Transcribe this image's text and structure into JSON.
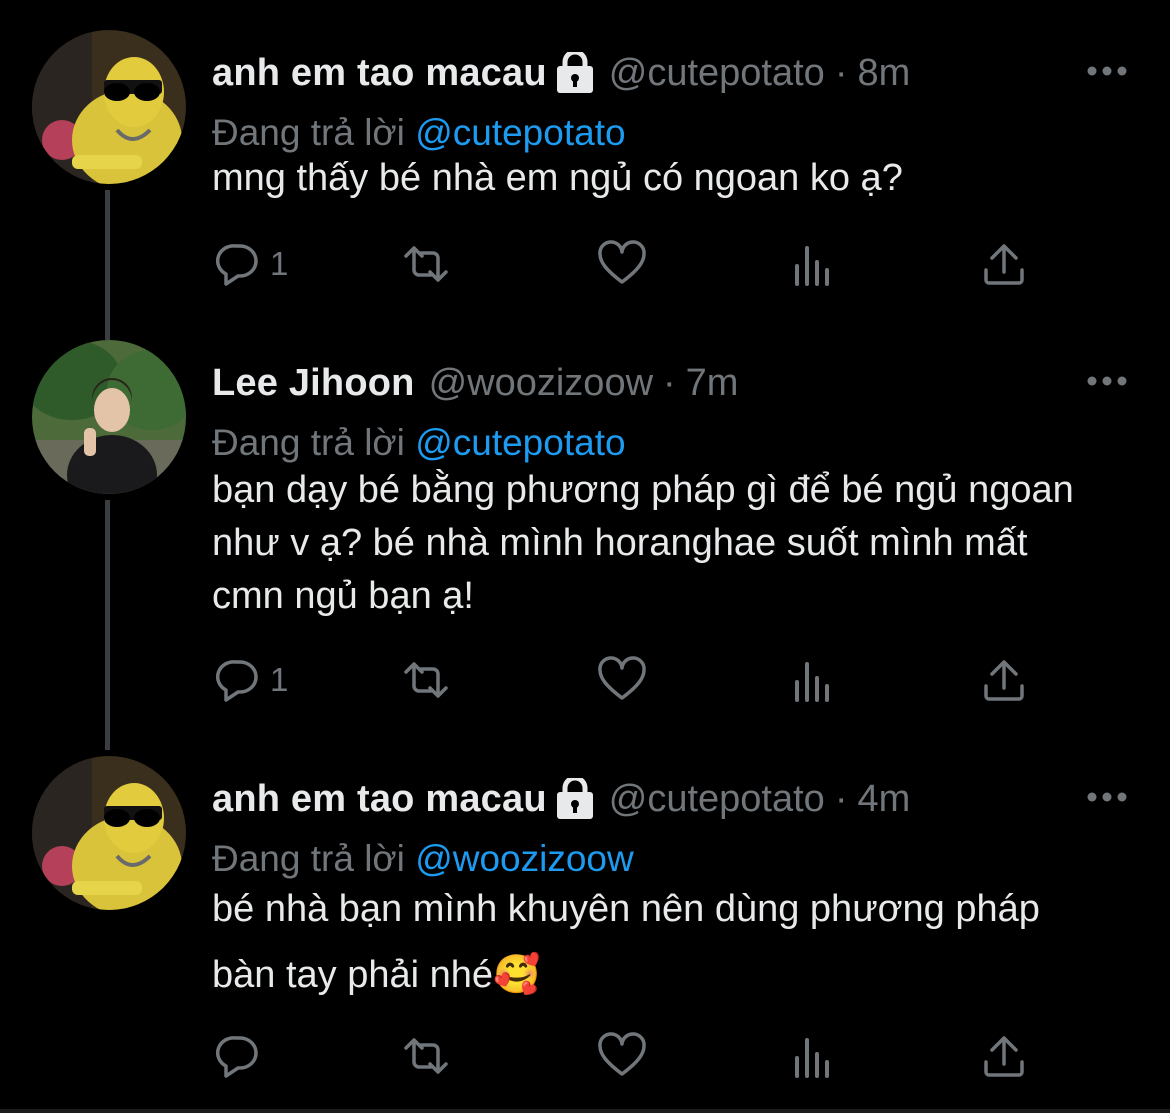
{
  "tweets": [
    {
      "display_name": "anh em tao macau",
      "locked": true,
      "handle": "@cutepotato",
      "separator": "·",
      "time": "8m",
      "reply_prefix": "Đang trả lời",
      "reply_to": "@cutepotato",
      "text": "mng thấy bé nhà em ngủ có ngoan ko ạ?",
      "reply_count": "1",
      "avatar": "dog-sunglasses-avatar"
    },
    {
      "display_name": "Lee Jihoon",
      "locked": false,
      "handle": "@woozizoow",
      "separator": "·",
      "time": "7m",
      "reply_prefix": "Đang trả lời",
      "reply_to": "@cutepotato",
      "text": "bạn dạy bé bằng phương pháp gì để bé ngủ ngoan như v ạ? bé nhà mình horanghae suốt mình mất cmn ngủ bạn ạ!",
      "reply_count": "1",
      "avatar": "person-peace-sign-avatar"
    },
    {
      "display_name": "anh em tao macau",
      "locked": true,
      "handle": "@cutepotato",
      "separator": "·",
      "time": "4m",
      "reply_prefix": "Đang trả lời",
      "reply_to": "@woozizoow",
      "text": "bé nhà bạn mình khuyên nên dùng phương pháp bàn tay phải nhé🥰",
      "reply_count": "",
      "avatar": "dog-sunglasses-avatar"
    }
  ],
  "icons": {
    "reply": "reply-icon",
    "retweet": "retweet-icon",
    "like": "heart-icon",
    "views": "views-chart-icon",
    "share": "share-icon",
    "more": "more-options-icon",
    "lock": "lock-icon"
  },
  "colors": {
    "background": "#000000",
    "text": "#e7e9ea",
    "secondary": "#71767b",
    "link": "#1d9bf0",
    "thread_line": "#3a3d41"
  }
}
